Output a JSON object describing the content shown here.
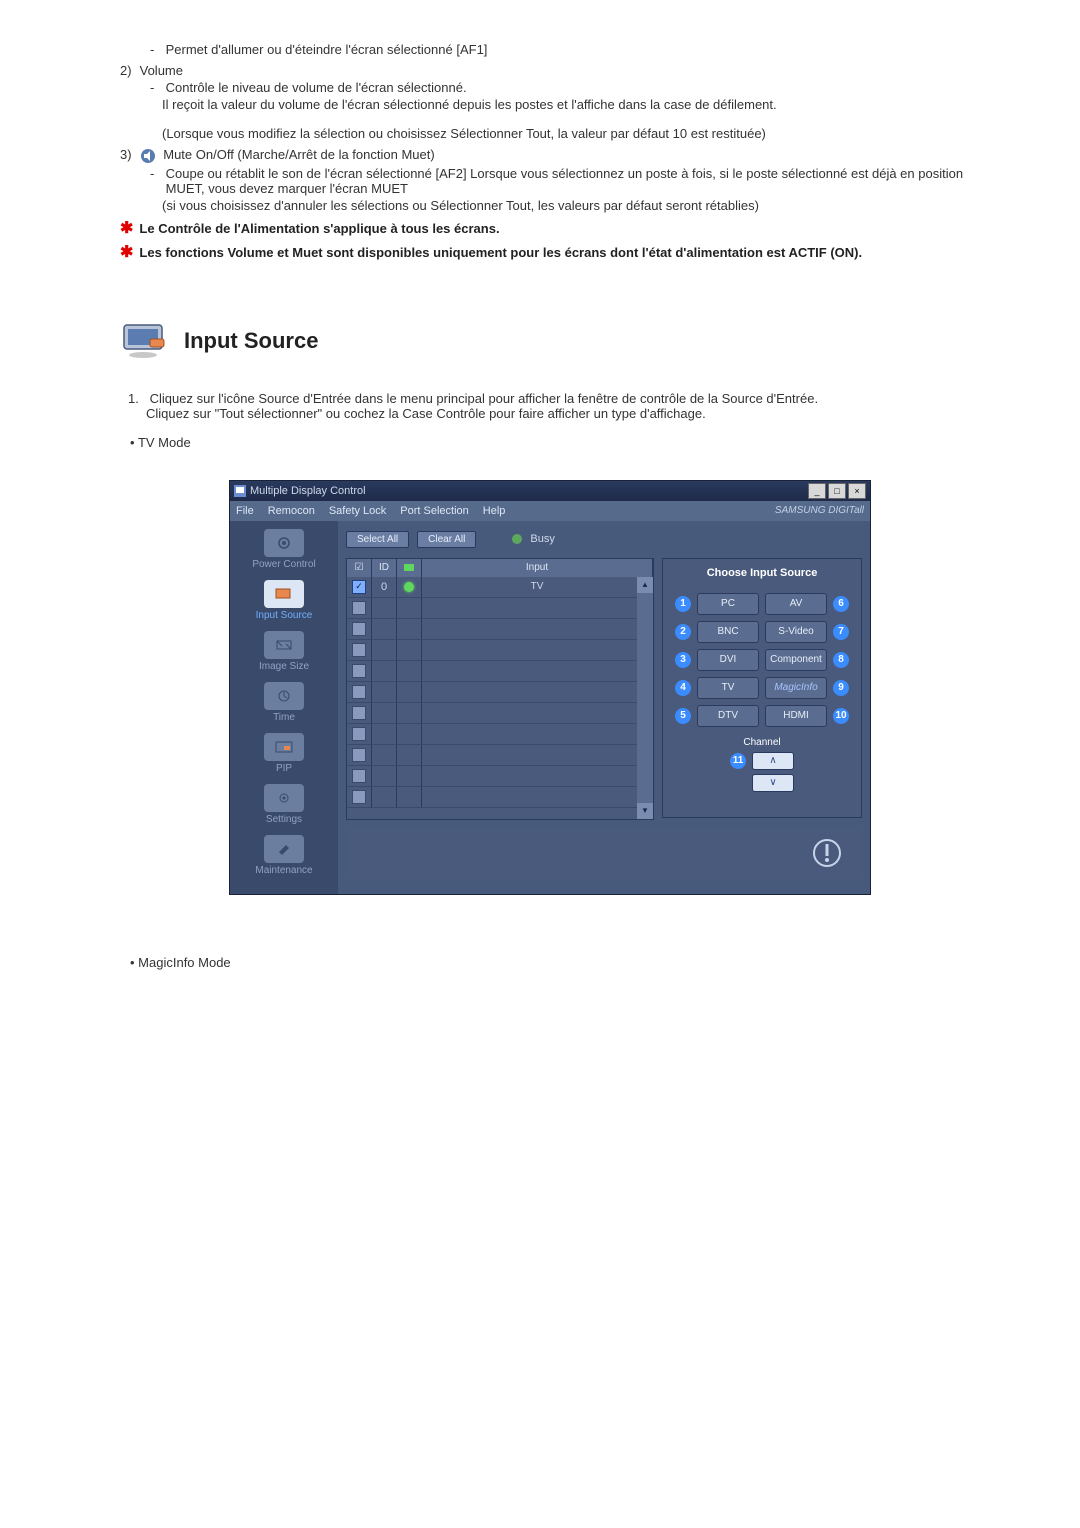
{
  "top": {
    "item1_sub": "Permet d'allumer ou d'éteindre l'écran sélectionné [AF1]",
    "item2_num": "2)",
    "item2_label": "Volume",
    "item2_sub1": "Contrôle le niveau de volume de l'écran sélectionné.",
    "item2_sub1_detail": "Il reçoit la valeur du volume de l'écran sélectionné depuis les postes et l'affiche dans la case de défilement.",
    "item2_sub1_detail2": "(Lorsque vous modifiez la sélection ou choisissez Sélectionner Tout, la valeur par défaut 10 est restituée)",
    "item3_num": "3)",
    "item3_label": "Mute On/Off (Marche/Arrêt de la fonction Muet)",
    "item3_sub1": "Coupe ou rétablit le son de l'écran sélectionné [AF2] Lorsque vous sélectionnez un poste à fois, si le poste sélectionné est déjà en position MUET, vous devez marquer l'écran MUET",
    "item3_sub1_detail": "(si vous choisissez d'annuler les sélections ou Sélectionner Tout, les valeurs par défaut seront rétablies)",
    "star1": "Le Contrôle de l'Alimentation s'applique à tous les écrans.",
    "star2": "Les fonctions Volume et Muet sont disponibles uniquement pour les écrans dont l'état d'alimentation est ACTIF (ON)."
  },
  "section": {
    "title": "Input Source",
    "desc1": "Cliquez sur l'icône Source d'Entrée dans le menu principal pour afficher la fenêtre de contrôle de la Source d'Entrée.",
    "desc1b": "Cliquez sur \"Tout sélectionner\" ou cochez la Case Contrôle pour faire afficher un type d'affichage.",
    "bullet1": "TV Mode",
    "bullet2": "MagicInfo Mode"
  },
  "app": {
    "title": "Multiple Display Control",
    "menu": [
      "File",
      "Remocon",
      "Safety Lock",
      "Port Selection",
      "Help"
    ],
    "brand": "SAMSUNG DIGITall",
    "btn_select_all": "Select All",
    "btn_clear_all": "Clear All",
    "busy": "Busy",
    "grid_headers": {
      "chk": "☑",
      "id": "ID",
      "led": "",
      "input": "Input"
    },
    "row0": {
      "id": "0",
      "input": "TV"
    },
    "sidebar": [
      {
        "label": "Power Control"
      },
      {
        "label": "Input Source",
        "highlight": true
      },
      {
        "label": "Image Size"
      },
      {
        "label": "Time"
      },
      {
        "label": "PIP"
      },
      {
        "label": "Settings"
      },
      {
        "label": "Maintenance"
      }
    ],
    "panel_title": "Choose Input Source",
    "sources_left": [
      "PC",
      "BNC",
      "DVI",
      "TV",
      "DTV"
    ],
    "sources_right": [
      "AV",
      "S-Video",
      "Component",
      "MagicInfo",
      "HDMI"
    ],
    "channel_label": "Channel",
    "channel_num11": "11"
  }
}
